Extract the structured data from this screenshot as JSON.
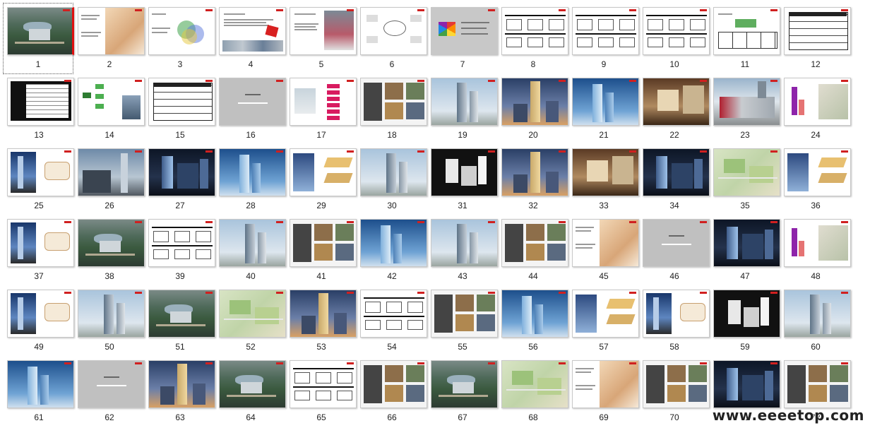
{
  "slides": [
    {
      "number": "1",
      "style": "aerial",
      "selected": true
    },
    {
      "number": "2",
      "style": "interior-warm"
    },
    {
      "number": "3",
      "style": "diagram-circles"
    },
    {
      "number": "4",
      "style": "text-icon"
    },
    {
      "number": "5",
      "style": "text-building"
    },
    {
      "number": "6",
      "style": "mindmap"
    },
    {
      "number": "7",
      "style": "gray-hexagon"
    },
    {
      "number": "8",
      "style": "sections"
    },
    {
      "number": "9",
      "style": "sections"
    },
    {
      "number": "10",
      "style": "sections"
    },
    {
      "number": "11",
      "style": "table-small"
    },
    {
      "number": "12",
      "style": "table"
    },
    {
      "number": "13",
      "style": "table-dark"
    },
    {
      "number": "14",
      "style": "mindmap-green"
    },
    {
      "number": "15",
      "style": "table"
    },
    {
      "number": "16",
      "style": "gray-title"
    },
    {
      "number": "17",
      "style": "flow-pink"
    },
    {
      "number": "18",
      "style": "collage-dark"
    },
    {
      "number": "19",
      "style": "tower-sky"
    },
    {
      "number": "20",
      "style": "tower-dusk"
    },
    {
      "number": "21",
      "style": "tower-blue"
    },
    {
      "number": "22",
      "style": "interior-room"
    },
    {
      "number": "23",
      "style": "mall"
    },
    {
      "number": "24",
      "style": "chart-plan"
    },
    {
      "number": "25",
      "style": "tower-plan"
    },
    {
      "number": "26",
      "style": "street-tower"
    },
    {
      "number": "27",
      "style": "night-complex"
    },
    {
      "number": "28",
      "style": "tower-blue"
    },
    {
      "number": "29",
      "style": "tower-diagram"
    },
    {
      "number": "30",
      "style": "tower-sky"
    },
    {
      "number": "31",
      "style": "massing-dark"
    },
    {
      "number": "32",
      "style": "tower-dusk"
    },
    {
      "number": "33",
      "style": "interior-room"
    },
    {
      "number": "34",
      "style": "night-complex"
    },
    {
      "number": "35",
      "style": "masterplan"
    },
    {
      "number": "36",
      "style": "tower-diagram"
    },
    {
      "number": "37",
      "style": "tower-plan"
    },
    {
      "number": "38",
      "style": "aerial"
    },
    {
      "number": "39",
      "style": "sections"
    },
    {
      "number": "40",
      "style": "tower-sky"
    },
    {
      "number": "41",
      "style": "collage-dark"
    },
    {
      "number": "42",
      "style": "tower-blue"
    },
    {
      "number": "43",
      "style": "tower-sky"
    },
    {
      "number": "44",
      "style": "collage-dark"
    },
    {
      "number": "45",
      "style": "interior-warm"
    },
    {
      "number": "46",
      "style": "gray-title"
    },
    {
      "number": "47",
      "style": "night-complex"
    },
    {
      "number": "48",
      "style": "chart-plan"
    },
    {
      "number": "49",
      "style": "tower-plan"
    },
    {
      "number": "50",
      "style": "tower-sky"
    },
    {
      "number": "51",
      "style": "aerial"
    },
    {
      "number": "52",
      "style": "masterplan"
    },
    {
      "number": "53",
      "style": "tower-dusk"
    },
    {
      "number": "54",
      "style": "sections"
    },
    {
      "number": "55",
      "style": "collage-dark"
    },
    {
      "number": "56",
      "style": "tower-blue"
    },
    {
      "number": "57",
      "style": "tower-diagram"
    },
    {
      "number": "58",
      "style": "tower-plan"
    },
    {
      "number": "59",
      "style": "massing-dark"
    },
    {
      "number": "60",
      "style": "tower-sky"
    },
    {
      "number": "61",
      "style": "tower-blue"
    },
    {
      "number": "62",
      "style": "gray-title"
    },
    {
      "number": "63",
      "style": "tower-dusk"
    },
    {
      "number": "64",
      "style": "aerial"
    },
    {
      "number": "65",
      "style": "sections"
    },
    {
      "number": "66",
      "style": "collage-dark"
    },
    {
      "number": "67",
      "style": "aerial"
    },
    {
      "number": "68",
      "style": "masterplan"
    },
    {
      "number": "69",
      "style": "interior-warm"
    },
    {
      "number": "70",
      "style": "collage-dark"
    },
    {
      "number": "71",
      "style": "night-complex"
    },
    {
      "number": "72",
      "style": "collage-dark"
    }
  ],
  "watermark": "www.eeeetop.com",
  "colors": {
    "selection_marker": "#e01010",
    "thumb_border": "#c8c8c8",
    "number_text": "#222222"
  }
}
